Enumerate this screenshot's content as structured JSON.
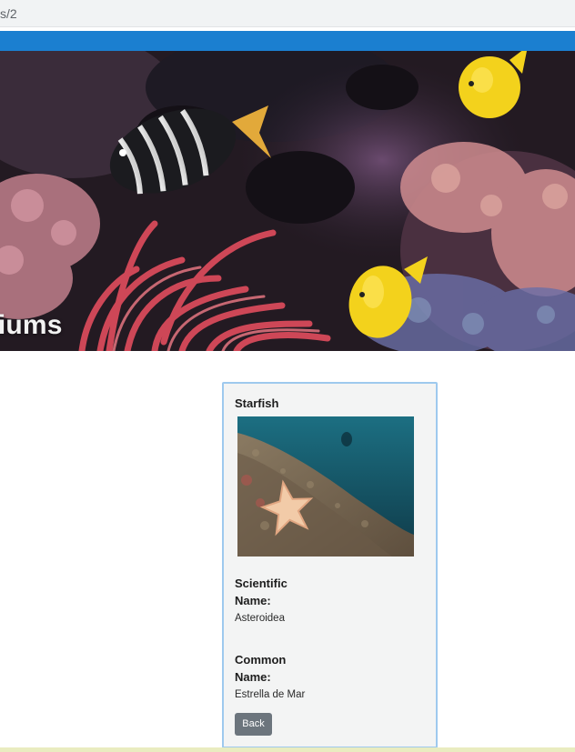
{
  "browser": {
    "url_fragment": "s/2"
  },
  "hero": {
    "title": "riums"
  },
  "card": {
    "title": "Starfish",
    "scientific_label": "Scientific Name:",
    "scientific_value": "Asteroidea",
    "common_label": "Common Name:",
    "common_value": "Estrella de Mar",
    "back_label": "Back"
  },
  "colors": {
    "nav_accent": "#1b7fd0",
    "card_border": "#9ec9ee",
    "button_bg": "#6c757d"
  }
}
